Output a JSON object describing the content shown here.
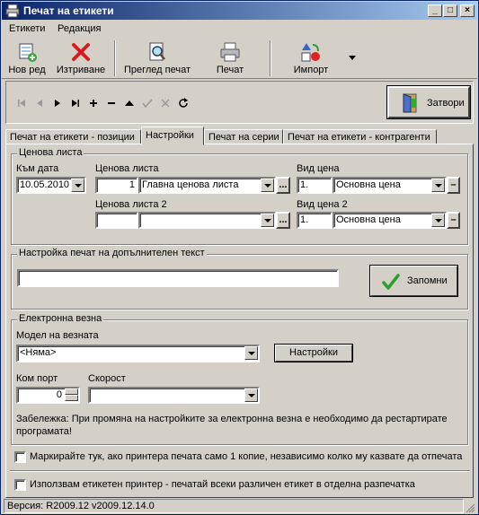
{
  "window": {
    "title": "Печат на етикети",
    "minimize": "_",
    "maximize": "□",
    "close": "×"
  },
  "menu": {
    "items": [
      "Етикети",
      "Редакция"
    ]
  },
  "toolbar": {
    "new_row": "Нов ред",
    "delete": "Изтриване",
    "preview": "Преглед печат",
    "print": "Печат",
    "import": "Импорт"
  },
  "nav": {
    "close_label": "Затвори"
  },
  "tabs": [
    "Печат на етикети - позиции",
    "Настройки",
    "Печат на серии",
    "Печат на етикети - контрагенти"
  ],
  "price_list": {
    "group_title": "Ценова листа",
    "date_label": "Към дата",
    "date_value": "10.05.2010",
    "list_label": "Ценова листа",
    "list_code": "1",
    "list_name": "Главна ценова листа",
    "price_type_label": "Вид цена",
    "price_type_code": "1.",
    "price_type_name": "Основна цена",
    "list2_label": "Ценова листа 2",
    "list2_code": "",
    "list2_name": "",
    "price_type2_label": "Вид цена 2",
    "price_type2_code": "1.",
    "price_type2_name": "Основна цена",
    "ellipsis": "...",
    "minus": "–"
  },
  "extra_text": {
    "group_title": "Настройка печат на допълнителен текст",
    "value": "",
    "save_label": "Запомни"
  },
  "scale": {
    "group_title": "Електронна везна",
    "model_label": "Модел на везната",
    "model_value": "<Няма>",
    "settings_label": "Настройки",
    "port_label": "Ком порт",
    "port_value": "0",
    "speed_label": "Скорост",
    "speed_value": "",
    "note": "Забележка: При промяна на настройките за електронна везна е необходимо да рестартирате програмата!"
  },
  "options": {
    "single_copy": "Маркирайте тук, ако принтера печата само 1 копие, независимо колко му казвате да отпечата",
    "label_printer": "Използвам етикетен принтер - печатай всеки различен етикет в отделна разпечатка"
  },
  "status": {
    "version": "Версия: R2009.12 v2009.12.14.0"
  }
}
